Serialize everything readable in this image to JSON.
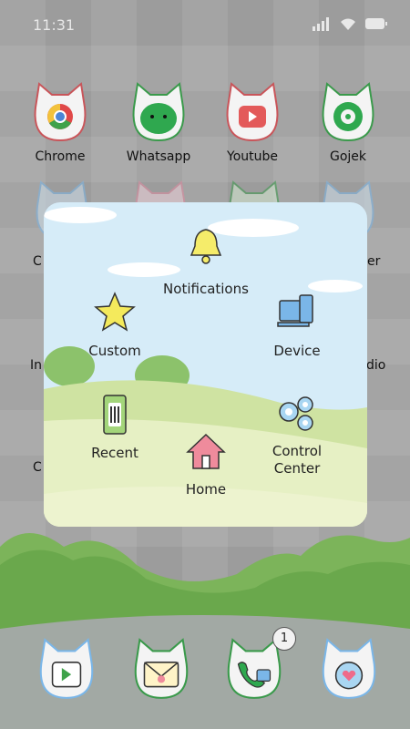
{
  "status_bar": {
    "time": "11:31"
  },
  "home_apps": [
    {
      "label": "Chrome",
      "color": "#d9534f"
    },
    {
      "label": "Whatsapp",
      "color": "#2fa84f"
    },
    {
      "label": "Youtube",
      "color": "#d9534f"
    },
    {
      "label": "Gojek",
      "color": "#2fa84f"
    }
  ],
  "partial_labels": {
    "row2_left": "C",
    "row2_right": "er",
    "row3_left": "In",
    "row3_right": "dio",
    "row4_left": "C"
  },
  "control_panel": {
    "notifications": "Notifications",
    "custom": "Custom",
    "device": "Device",
    "recent": "Recent",
    "control_center_line1": "Control",
    "control_center_line2": "Center",
    "home": "Home"
  },
  "dock": {
    "items": [
      "play-store-icon",
      "messages-icon",
      "phone-icon",
      "settings-icon"
    ],
    "badge_count": "1"
  },
  "colors": {
    "sky": "#d6ecf8",
    "grass": "#e8f1c6",
    "bell": "#f5ec6a",
    "star": "#f4ea5c",
    "device": "#7ab6e8",
    "home": "#ef8b9c"
  }
}
